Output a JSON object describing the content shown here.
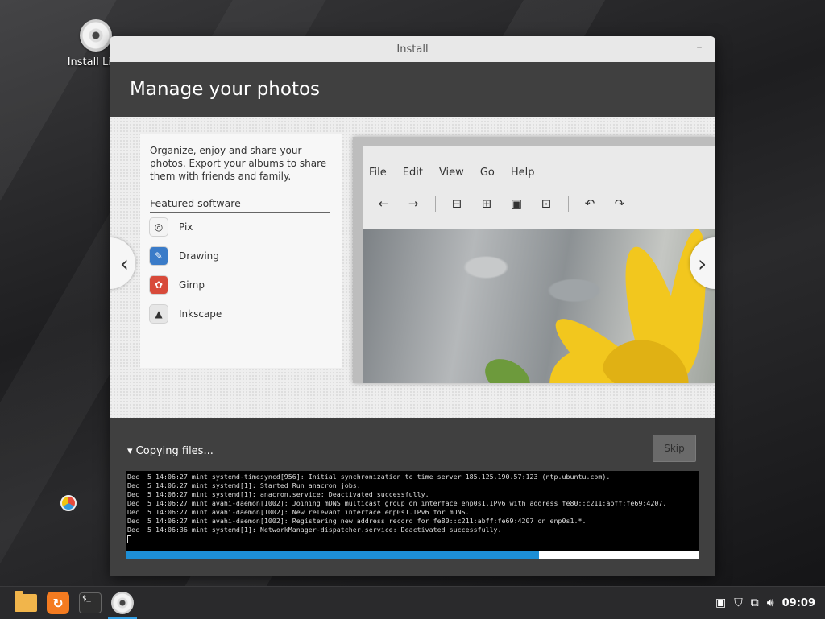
{
  "desktop": {
    "icon_label": "Install Linu"
  },
  "window": {
    "title": "Install",
    "minimize": "–"
  },
  "slide": {
    "header": "Manage your photos",
    "description": "Organize, enjoy and share your photos. Export your albums to share them with friends and family.",
    "featured_title": "Featured software",
    "apps": [
      {
        "name": "Pix",
        "icon": "pix-icon",
        "color": "#f4f4f4"
      },
      {
        "name": "Drawing",
        "icon": "drawing-icon",
        "color": "#3a7bc8"
      },
      {
        "name": "Gimp",
        "icon": "gimp-icon",
        "color": "#d84a3a"
      },
      {
        "name": "Inkscape",
        "icon": "inkscape-icon",
        "color": "#e6e6e6"
      }
    ],
    "screenshot_menu": [
      "File",
      "Edit",
      "View",
      "Go",
      "Help"
    ],
    "prev_arrow": "‹",
    "next_arrow": "›"
  },
  "status": {
    "expander_label": "Copying files...",
    "skip_label": "Skip",
    "progress": 0.72,
    "log": [
      "Dec  5 14:06:27 mint systemd-timesyncd[956]: Initial synchronization to time server 185.125.190.57:123 (ntp.ubuntu.com).",
      "Dec  5 14:06:27 mint systemd[1]: Started Run anacron jobs.",
      "Dec  5 14:06:27 mint systemd[1]: anacron.service: Deactivated successfully.",
      "Dec  5 14:06:27 mint avahi-daemon[1002]: Joining mDNS multicast group on interface enp0s1.IPv6 with address fe80::c211:abff:fe69:4207.",
      "Dec  5 14:06:27 mint avahi-daemon[1002]: New relevant interface enp0s1.IPv6 for mDNS.",
      "Dec  5 14:06:27 mint avahi-daemon[1002]: Registering new address record for fe80::c211:abff:fe69:4207 on enp0s1.*.",
      "Dec  5 14:06:36 mint systemd[1]: NetworkManager-dispatcher.service: Deactivated successfully."
    ]
  },
  "taskbar": {
    "clock": "09:09"
  }
}
